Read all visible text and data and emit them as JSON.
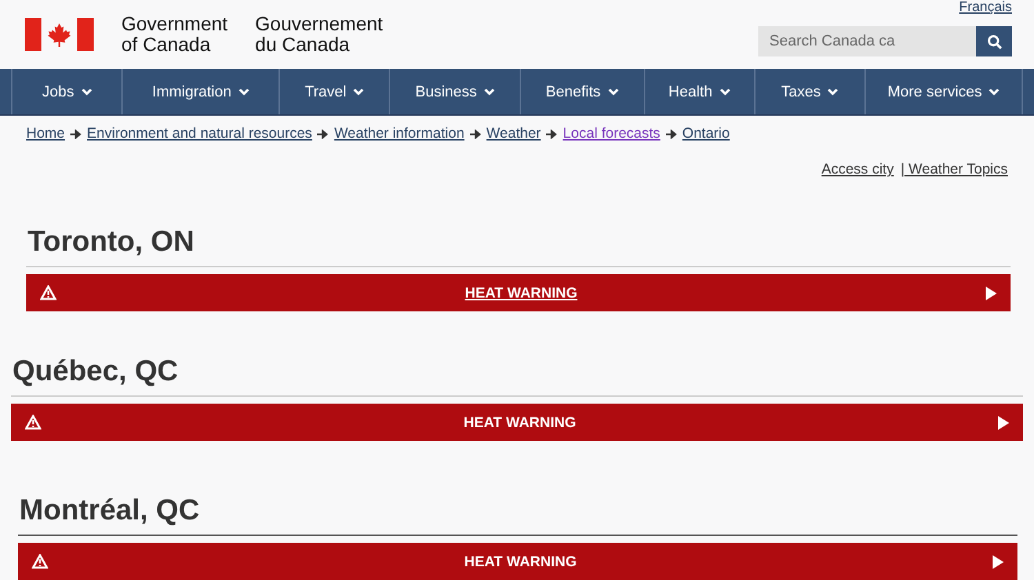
{
  "language_link": "Français",
  "brand": {
    "english": [
      "Government",
      "of Canada"
    ],
    "french": [
      "Gouvernement",
      "du Canada"
    ]
  },
  "search": {
    "placeholder": "Search Canada ca"
  },
  "nav": [
    {
      "label": "Jobs"
    },
    {
      "label": "Immigration"
    },
    {
      "label": "Travel"
    },
    {
      "label": "Business"
    },
    {
      "label": "Benefits"
    },
    {
      "label": "Health"
    },
    {
      "label": "Taxes"
    },
    {
      "label": "More services"
    }
  ],
  "breadcrumb": [
    {
      "label": "Home",
      "visited": false
    },
    {
      "label": "Environment and natural resources",
      "visited": false
    },
    {
      "label": "Weather information",
      "visited": false
    },
    {
      "label": "Weather",
      "visited": false
    },
    {
      "label": "Local forecasts",
      "visited": true
    },
    {
      "label": "Ontario",
      "visited": false
    }
  ],
  "utility_links": [
    "Access city",
    "| Weather Topics"
  ],
  "cities": [
    {
      "name": "Toronto, ON",
      "alert": {
        "label": "HEAT WARNING",
        "underlined": true
      }
    },
    {
      "name": "Québec, QC",
      "alert": {
        "label": "HEAT WARNING",
        "underlined": false
      }
    },
    {
      "name": "Montréal, QC",
      "alert": {
        "label": "HEAT WARNING",
        "underlined": false
      }
    }
  ]
}
